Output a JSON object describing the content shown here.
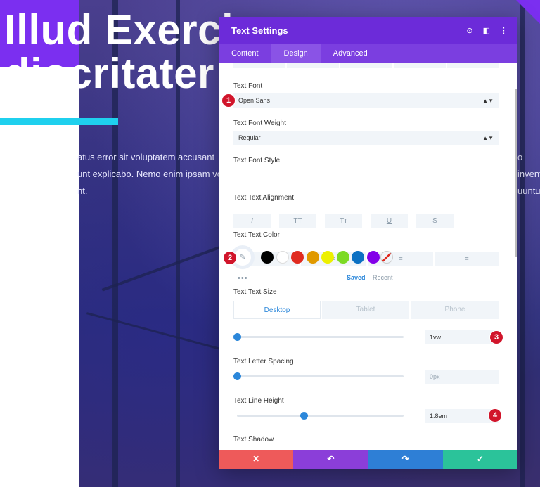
{
  "hero": {
    "title_line1": "Illud Exerci",
    "title_line2": "diocritater",
    "body_left": "atus error sit voluptatem accusant\nunt explicabo. Nemo enim ipsam vo\nnt.",
    "body_right": "o invent\nuuntur"
  },
  "modal": {
    "title": "Text Settings",
    "header_icons": [
      "target-icon",
      "split-view-icon",
      "more-vertical-icon"
    ],
    "tabs": [
      "Content",
      "Design",
      "Advanced"
    ],
    "active_tab": "Design",
    "fields": {
      "text_font": {
        "label": "Text Font",
        "value": "Open Sans"
      },
      "text_font_weight": {
        "label": "Text Font Weight",
        "value": "Regular"
      },
      "text_font_style": {
        "label": "Text Font Style",
        "buttons": [
          "I",
          "TT",
          "Tт",
          "U",
          "S"
        ]
      },
      "text_alignment": {
        "label": "Text Text Alignment",
        "buttons": [
          "≡",
          "≡",
          "≡",
          "≡"
        ]
      },
      "text_color": {
        "label": "Text Text Color",
        "swatches": [
          "#000000",
          "#ffffff",
          "#e02b20",
          "#e09900",
          "#edf000",
          "#7cda24",
          "#0c71c3",
          "#8300e9"
        ],
        "saved_label": "Saved",
        "recent_label": "Recent"
      },
      "text_size": {
        "label": "Text Text Size",
        "devices": [
          "Desktop",
          "Tablet",
          "Phone"
        ],
        "active_device": "Desktop",
        "value": "1vw",
        "slider_fraction": 0.0
      },
      "letter_spacing": {
        "label": "Text Letter Spacing",
        "value": "0px",
        "slider_fraction": 0.0
      },
      "line_height": {
        "label": "Text Line Height",
        "value": "1.8em",
        "slider_fraction": 0.4
      },
      "text_shadow": {
        "label": "Text Shadow"
      }
    },
    "markers": [
      "1",
      "2",
      "3",
      "4"
    ],
    "footer": {
      "cancel": "✕",
      "undo": "↶",
      "redo": "↷",
      "save": "✓"
    },
    "colors": {
      "header": "#6c2bd9",
      "tabs": "#7b3ee0",
      "cancel": "#ee5a5a",
      "undo": "#8b3ed9",
      "redo": "#2e7fd6",
      "save": "#2bc39a",
      "marker": "#d1152b",
      "accent_bar": "#1fd0ee",
      "slider": "#2b87da"
    }
  }
}
